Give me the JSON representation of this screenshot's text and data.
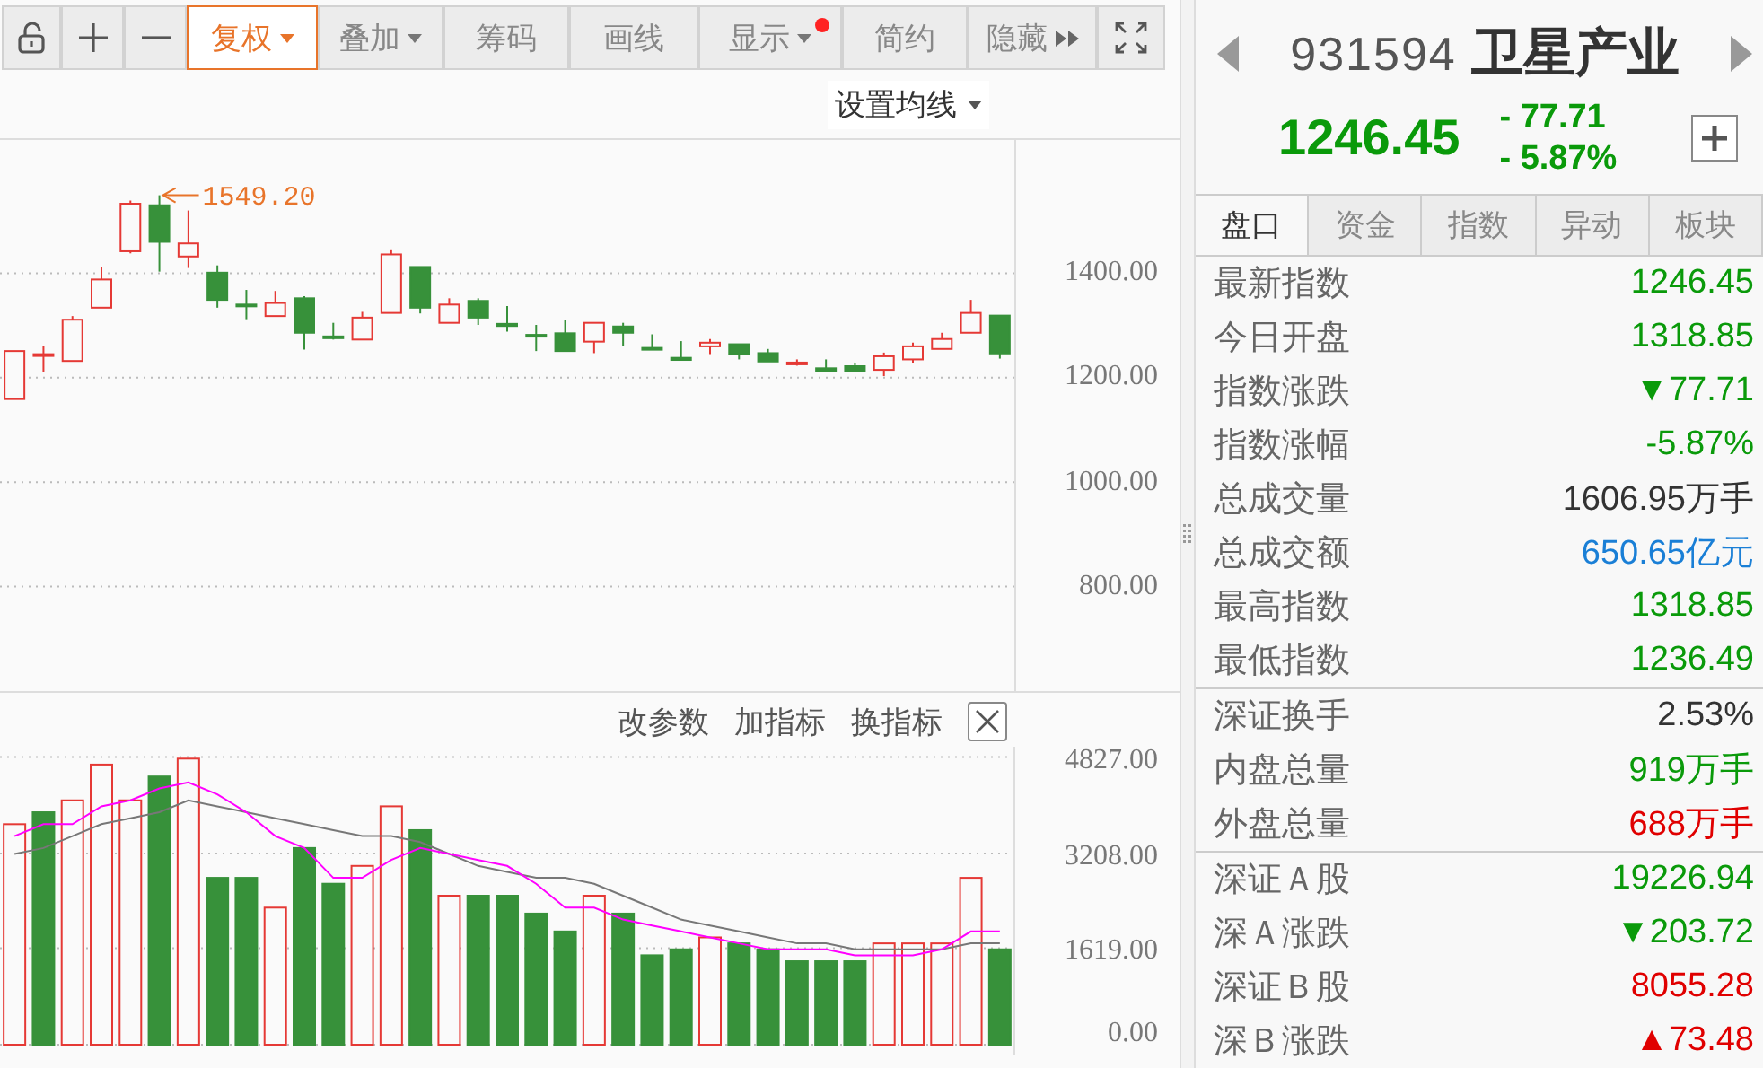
{
  "toolbar": {
    "buttons": [
      {
        "label": "复权",
        "kind": "dropdown",
        "selected": true,
        "dot": false
      },
      {
        "label": "叠加",
        "kind": "dropdown",
        "selected": false,
        "dot": false
      },
      {
        "label": "筹码",
        "kind": "plain",
        "selected": false,
        "dot": false
      },
      {
        "label": "画线",
        "kind": "plain",
        "selected": false,
        "dot": false
      },
      {
        "label": "显示",
        "kind": "dropdown",
        "selected": false,
        "dot": true
      },
      {
        "label": "简约",
        "kind": "plain",
        "selected": false,
        "dot": false
      },
      {
        "label": "隐藏",
        "kind": "more",
        "selected": false,
        "dot": false
      }
    ]
  },
  "main_chart": {
    "ma_button": "设置均线",
    "chart_data": {
      "type": "candlestick",
      "grid": true,
      "ylim": [
        600,
        1655
      ],
      "categories": [
        null,
        null,
        null,
        null,
        null,
        null,
        null,
        null,
        null,
        null,
        null,
        null,
        null,
        null,
        null,
        null,
        null,
        null,
        null,
        null,
        null,
        null,
        null,
        null,
        null,
        null,
        null,
        null,
        null,
        null,
        null,
        null,
        null,
        null,
        null
      ],
      "ohlc": [
        [
          1159,
          1251,
          1159,
          1251
        ],
        [
          1244,
          1261,
          1210,
          1245
        ],
        [
          1232,
          1318,
          1232,
          1311
        ],
        [
          1334,
          1412,
          1334,
          1388
        ],
        [
          1442,
          1539,
          1438,
          1533
        ],
        [
          1530,
          1549.2,
          1403,
          1460
        ],
        [
          1432,
          1520,
          1410,
          1457
        ],
        [
          1401,
          1415,
          1334,
          1349
        ],
        [
          1340,
          1368,
          1312,
          1339
        ],
        [
          1318,
          1366,
          1318,
          1343
        ],
        [
          1352,
          1356,
          1254,
          1286
        ],
        [
          1279,
          1305,
          1273,
          1277
        ],
        [
          1273,
          1326,
          1273,
          1315
        ],
        [
          1324,
          1444,
          1324,
          1436
        ],
        [
          1412,
          1412,
          1323,
          1334
        ],
        [
          1305,
          1352,
          1305,
          1340
        ],
        [
          1347,
          1352,
          1301,
          1315
        ],
        [
          1303,
          1337,
          1288,
          1299
        ],
        [
          1282,
          1301,
          1251,
          1281
        ],
        [
          1285,
          1311,
          1251,
          1251
        ],
        [
          1269,
          1305,
          1247,
          1305
        ],
        [
          1298,
          1305,
          1261,
          1286
        ],
        [
          1257,
          1283,
          1256,
          1256
        ],
        [
          1238,
          1270,
          1234,
          1234
        ],
        [
          1260,
          1274,
          1245,
          1267
        ],
        [
          1264,
          1264,
          1235,
          1245
        ],
        [
          1247,
          1255,
          1231,
          1231
        ],
        [
          1227,
          1235,
          1223,
          1229
        ],
        [
          1218,
          1235,
          1213,
          1213
        ],
        [
          1222,
          1229,
          1210,
          1213
        ],
        [
          1215,
          1248,
          1203,
          1241
        ],
        [
          1235,
          1267,
          1228,
          1260
        ],
        [
          1255,
          1286,
          1255,
          1274
        ],
        [
          1286,
          1349,
          1286,
          1324
        ],
        [
          1318.85,
          1318.85,
          1236.49,
          1246.45
        ]
      ],
      "yticks": [
        {
          "value": 800,
          "label": "800.00"
        },
        {
          "value": 1000,
          "label": "1000.00"
        },
        {
          "value": 1200,
          "label": "1200.00"
        },
        {
          "value": 1400,
          "label": "1400.00"
        }
      ],
      "annotations": [
        "1549.20"
      ]
    }
  },
  "volume_chart": {
    "actions": [
      "改参数",
      "加指标",
      "换指标"
    ],
    "chart_data": {
      "type": "bar",
      "grid": true,
      "ylim": [
        0,
        5000
      ],
      "yticks": [
        {
          "value": 0,
          "label": "0.00"
        },
        {
          "value": 1619,
          "label": "1619.00"
        },
        {
          "value": 3208,
          "label": "3208.00"
        },
        {
          "value": 4827,
          "label": "4827.00"
        }
      ],
      "series": [
        {
          "colors": [
            "#e53935",
            "#37913a",
            "#e53935",
            "#e53935",
            "#e53935",
            "#37913a",
            "#e53935",
            "#37913a",
            "#37913a",
            "#e53935",
            "#37913a",
            "#37913a",
            "#e53935",
            "#e53935",
            "#37913a",
            "#e53935",
            "#37913a",
            "#37913a",
            "#37913a",
            "#37913a",
            "#e53935",
            "#37913a",
            "#37913a",
            "#37913a",
            "#e53935",
            "#37913a",
            "#37913a",
            "#37913a",
            "#37913a",
            "#37913a",
            "#e53935",
            "#e53935",
            "#e53935",
            "#e53935",
            "#37913a"
          ],
          "values": [
            3700,
            3900,
            4100,
            4700,
            4100,
            4500,
            4800,
            2800,
            2800,
            2300,
            3300,
            2700,
            3000,
            4000,
            3600,
            2500,
            2500,
            2500,
            2200,
            1900,
            2500,
            2200,
            1500,
            1600,
            1800,
            1700,
            1600,
            1400,
            1400,
            1400,
            1700,
            1700,
            1700,
            2800,
            1600
          ]
        },
        {
          "type": "line",
          "color": "#777777",
          "values": [
            3200,
            3300,
            3500,
            3700,
            3800,
            3900,
            4100,
            4000,
            3900,
            3800,
            3700,
            3600,
            3500,
            3500,
            3400,
            3200,
            3000,
            2900,
            2800,
            2800,
            2700,
            2500,
            2300,
            2100,
            2000,
            1900,
            1800,
            1700,
            1700,
            1600,
            1600,
            1600,
            1600,
            1700,
            1700
          ]
        },
        {
          "type": "line",
          "color": "#ff00ff",
          "values": [
            3500,
            3700,
            3700,
            4000,
            4100,
            4300,
            4400,
            4200,
            3900,
            3500,
            3300,
            2800,
            2800,
            3100,
            3300,
            3200,
            3100,
            3000,
            2700,
            2300,
            2300,
            2100,
            2000,
            1900,
            1800,
            1700,
            1600,
            1600,
            1600,
            1500,
            1500,
            1500,
            1600,
            1900,
            1900
          ]
        }
      ]
    }
  },
  "quote": {
    "code": "931594",
    "name": "卫星产业",
    "price": "1246.45",
    "change": "- 77.71",
    "change_pct": "- 5.87%",
    "color": "#0a9a0a"
  },
  "tabs": [
    {
      "label": "盘口",
      "selected": true
    },
    {
      "label": "资金",
      "selected": false
    },
    {
      "label": "指数",
      "selected": false
    },
    {
      "label": "异动",
      "selected": false
    },
    {
      "label": "板块",
      "selected": false
    }
  ],
  "groups": [
    {
      "rows": [
        {
          "label": "最新指数",
          "value": "1246.45",
          "color": "#0a9a0a"
        },
        {
          "label": "今日开盘",
          "value": "1318.85",
          "color": "#0a9a0a"
        },
        {
          "label": "指数涨跌",
          "value": "▼77.71",
          "color": "#0a9a0a"
        },
        {
          "label": "指数涨幅",
          "value": "-5.87%",
          "color": "#0a9a0a"
        },
        {
          "label": "总成交量",
          "value": "1606.95万手",
          "color": "#333333"
        },
        {
          "label": "总成交额",
          "value": "650.65亿元",
          "color": "#1a7fd6"
        },
        {
          "label": "最高指数",
          "value": "1318.85",
          "color": "#0a9a0a"
        },
        {
          "label": "最低指数",
          "value": "1236.49",
          "color": "#0a9a0a"
        }
      ]
    },
    {
      "rows": [
        {
          "label": "深证换手",
          "value": "2.53%",
          "color": "#333333"
        },
        {
          "label": "内盘总量",
          "value": "919万手",
          "color": "#0a9a0a"
        },
        {
          "label": "外盘总量",
          "value": "688万手",
          "color": "#e00000"
        }
      ]
    },
    {
      "rows": [
        {
          "label": "深证Ａ股",
          "value": "19226.94",
          "color": "#0a9a0a"
        },
        {
          "label": "深Ａ涨跌",
          "value": "▼203.72",
          "color": "#0a9a0a"
        },
        {
          "label": "深证Ｂ股",
          "value": "8055.28",
          "color": "#e00000"
        },
        {
          "label": "深Ｂ涨跌",
          "value": "▲73.48",
          "color": "#e00000"
        }
      ]
    }
  ]
}
